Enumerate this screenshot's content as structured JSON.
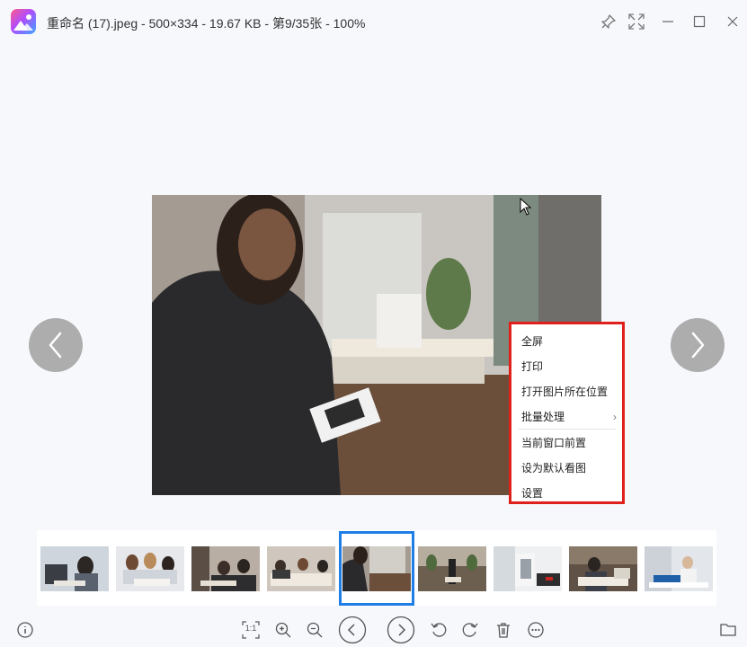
{
  "window": {
    "title": "重命名 (17).jpeg - 500×334 - 19.67 KB - 第9/35张 - 100%"
  },
  "titlebar_buttons": {
    "pin": "pin-icon",
    "fullscreen": "fullscreen-icon",
    "minimize": "minimize-icon",
    "maximize": "maximize-icon",
    "close": "close-icon"
  },
  "context_menu": {
    "items": [
      {
        "label": "全屏"
      },
      {
        "label": "打印"
      },
      {
        "label": "打开图片所在位置"
      },
      {
        "label": "批量处理",
        "submenu": "›"
      },
      {
        "label": "当前窗口前置"
      },
      {
        "label": "设为默认看图"
      },
      {
        "label": "设置"
      }
    ]
  },
  "filmstrip": {
    "count": 9,
    "selected_index": 4
  },
  "toolbar": {
    "actual_size_label": "1:1",
    "icons": [
      "info-icon",
      "actual-size-icon",
      "zoom-in-icon",
      "zoom-out-icon",
      "previous-icon",
      "next-icon",
      "rotate-left-icon",
      "rotate-right-icon",
      "delete-icon",
      "more-icon",
      "folder-icon"
    ]
  },
  "colors": {
    "accent_selected": "#1e7ee6",
    "highlight_box": "#e0201b",
    "background": "#f7f8fc"
  }
}
